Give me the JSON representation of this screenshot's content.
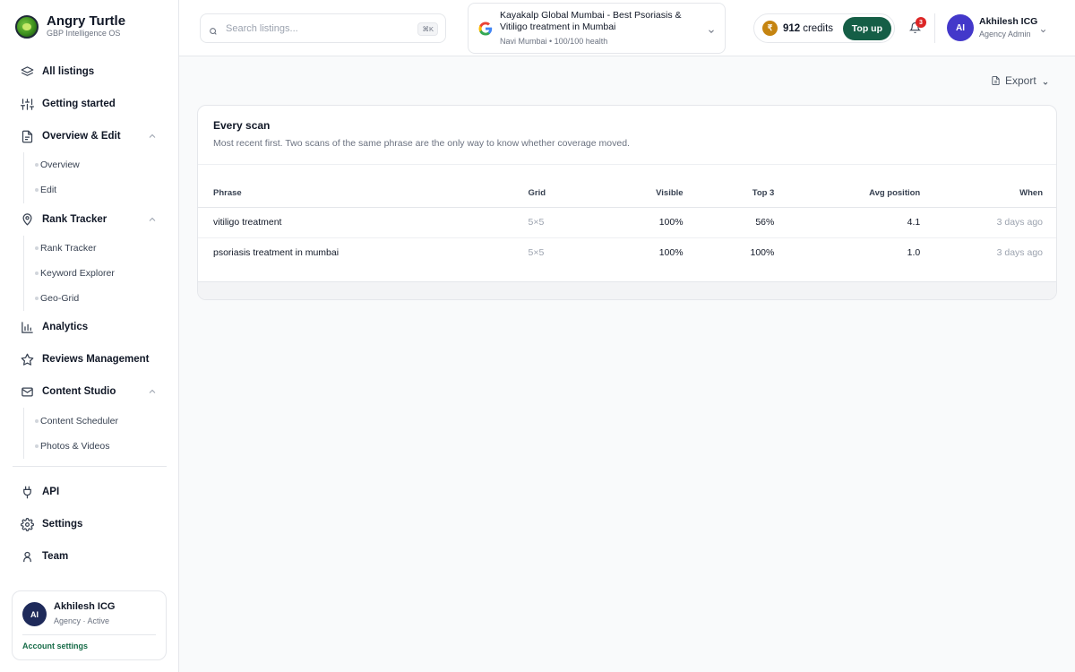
{
  "brand": {
    "name": "Angry Turtle",
    "tagline": "GBP Intelligence OS"
  },
  "sidebar": {
    "items": [
      {
        "label": "All listings",
        "icon": "layers-icon"
      },
      {
        "label": "Getting started",
        "icon": "sliders-icon"
      },
      {
        "label": "Overview & Edit",
        "icon": "document-icon",
        "expanded": true,
        "children": [
          "Overview",
          "Edit"
        ]
      },
      {
        "label": "Rank Tracker",
        "icon": "map-pin-icon",
        "expanded": true,
        "children": [
          "Rank Tracker",
          "Keyword Explorer",
          "Geo-Grid"
        ]
      },
      {
        "label": "Analytics",
        "icon": "bar-chart-icon"
      },
      {
        "label": "Reviews Management",
        "icon": "star-icon"
      },
      {
        "label": "Content Studio",
        "icon": "mail-icon",
        "expanded": true,
        "children": [
          "Content Scheduler",
          "Photos & Videos"
        ]
      },
      {
        "label": "API",
        "icon": "plug-icon"
      },
      {
        "label": "Settings",
        "icon": "gear-icon"
      },
      {
        "label": "Team",
        "icon": "user-icon"
      }
    ],
    "user_card": {
      "initials": "AI",
      "name": "Akhilesh ICG",
      "role": "Agency · Active",
      "link": "Account settings"
    }
  },
  "header": {
    "search": {
      "placeholder": "Search listings...",
      "shortcut": "⌘K"
    },
    "listing": {
      "title": "Kayakalp Global Mumbai - Best Psoriasis & Vitiligo treatment in Mumbai",
      "meta": "Navi Mumbai • 100/100 health"
    },
    "credits": {
      "amount": "912",
      "unit": "credits",
      "coin_symbol": "₹",
      "topup_label": "Top up"
    },
    "notifications": {
      "count": "3"
    },
    "user": {
      "initials": "AI",
      "name": "Akhilesh ICG",
      "role": "Agency Admin"
    }
  },
  "main": {
    "export_label": "Export",
    "card": {
      "title": "Every scan",
      "subtitle": "Most recent first. Two scans of the same phrase are the only way to know whether coverage moved.",
      "columns": [
        "Phrase",
        "Grid",
        "Visible",
        "Top 3",
        "Avg position",
        "When"
      ],
      "rows": [
        {
          "phrase": "vitiligo treatment",
          "grid": "5×5",
          "visible": "100%",
          "top3": "56%",
          "avg": "4.1",
          "when": "3 days ago"
        },
        {
          "phrase": "psoriasis treatment in mumbai",
          "grid": "5×5",
          "visible": "100%",
          "top3": "100%",
          "avg": "1.0",
          "when": "3 days ago"
        }
      ]
    }
  },
  "colors": {
    "accent": "#155e46",
    "badge": "#dc2626",
    "avatar": "#4338ca",
    "coin": "#c58410"
  }
}
